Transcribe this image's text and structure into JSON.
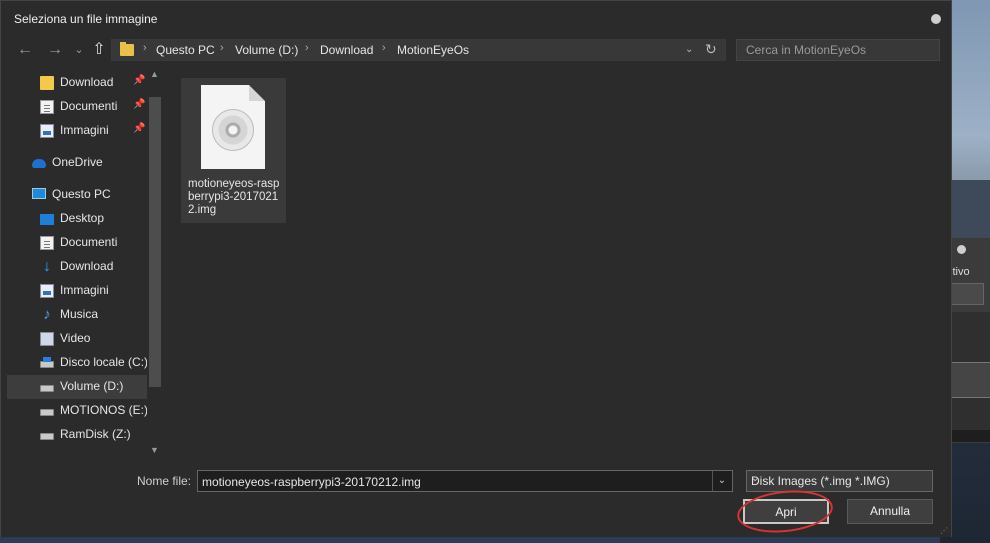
{
  "window": {
    "title": "Seleziona un file immagine"
  },
  "nav": {
    "back": "←",
    "forward": "→",
    "recent": "⌄",
    "up": "⇧"
  },
  "address": {
    "crumbs": [
      "Questo PC",
      "Volume (D:)",
      "Download",
      "MotionEyeOs"
    ],
    "separator": "›",
    "dropdown": "⌄",
    "refresh": "↻"
  },
  "search": {
    "placeholder": "Cerca in MotionEyeOs"
  },
  "sidebar": {
    "items": [
      {
        "label": "Download",
        "icon": "folder-icon",
        "pinned": true
      },
      {
        "label": "Documenti",
        "icon": "document-icon",
        "pinned": true
      },
      {
        "label": "Immagini",
        "icon": "pictures-icon",
        "pinned": true
      },
      {
        "label": "OneDrive",
        "icon": "cloud-icon"
      },
      {
        "label": "Questo PC",
        "icon": "computer-icon"
      },
      {
        "label": "Desktop",
        "icon": "desktop-icon"
      },
      {
        "label": "Documenti",
        "icon": "document-icon"
      },
      {
        "label": "Download",
        "icon": "download-icon"
      },
      {
        "label": "Immagini",
        "icon": "pictures-icon"
      },
      {
        "label": "Musica",
        "icon": "music-icon"
      },
      {
        "label": "Video",
        "icon": "video-icon"
      },
      {
        "label": "Disco locale (C:)",
        "icon": "drive-c-icon"
      },
      {
        "label": "Volume (D:)",
        "icon": "drive-icon",
        "selected": true
      },
      {
        "label": "MOTIONOS (E:)",
        "icon": "drive-icon"
      },
      {
        "label": "RamDisk (Z:)",
        "icon": "drive-icon"
      }
    ],
    "pin_glyph": "📌"
  },
  "files": [
    {
      "name": "motioneyeos-raspberrypi3-20170212.img",
      "icon": "disc-image-icon"
    }
  ],
  "footer": {
    "filename_label": "Nome file:",
    "filename_value": "motioneyeos-raspberrypi3-20170212.img",
    "filter_value": "Disk Images (*.img *.IMG)",
    "open_label": "Apri",
    "cancel_label": "Annulla"
  },
  "background_window": {
    "text": "itivo"
  },
  "colors": {
    "annotation": "#d93333",
    "folder": "#f2c94c",
    "accent": "#1d8ae0"
  }
}
